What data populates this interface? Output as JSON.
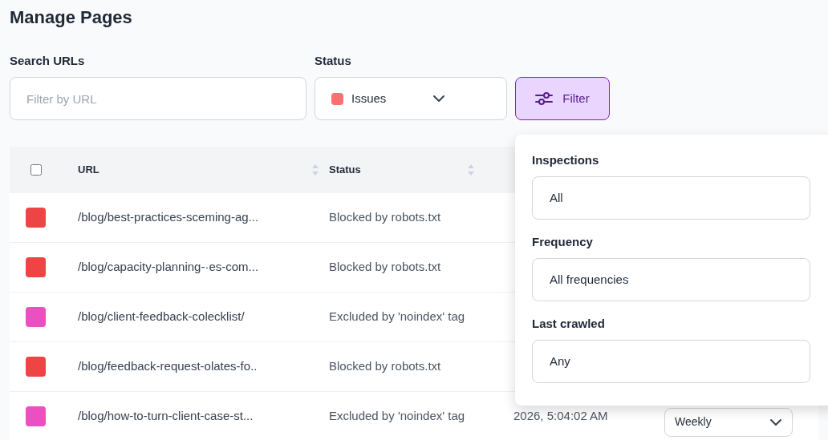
{
  "title": "Manage Pages",
  "search": {
    "label": "Search URLs",
    "placeholder": "Filter by URL"
  },
  "status_filter": {
    "label": "Status",
    "value": "Issues",
    "color": "#f87171"
  },
  "filter_button": {
    "label": "Filter",
    "selected": true
  },
  "table": {
    "select_all": {
      "checked": false
    },
    "columns": [
      "URL",
      "Status"
    ],
    "rows": [
      {
        "color": "#ef4444",
        "url": "/blog/best-practices-sceming-ag...",
        "status": "Blocked by robots.txt"
      },
      {
        "color": "#ef4444",
        "url": "/blog/capacity-planning-·es-com...",
        "status": "Blocked by robots.txt"
      },
      {
        "color": "#ec4fc0",
        "url": "/blog/client-feedback-colecklist/",
        "status": "Excluded by 'noindex' tag"
      },
      {
        "color": "#ef4444",
        "url": "/blog/feedback-request-olates-fo..",
        "status": "Blocked by robots.txt"
      },
      {
        "color": "#ec4fc0",
        "url": "/blog/how-to-turn-client-case-st...",
        "status": "Excluded by 'noindex' tag",
        "last_crawled": "2026, 5:04:02 AM",
        "frequency": "Weekly"
      }
    ]
  },
  "filter_panel": {
    "fields": [
      {
        "label": "Inspections",
        "value": "All"
      },
      {
        "label": "Frequency",
        "value": "All frequencies"
      },
      {
        "label": "Last crawled",
        "value": "Any"
      }
    ]
  }
}
